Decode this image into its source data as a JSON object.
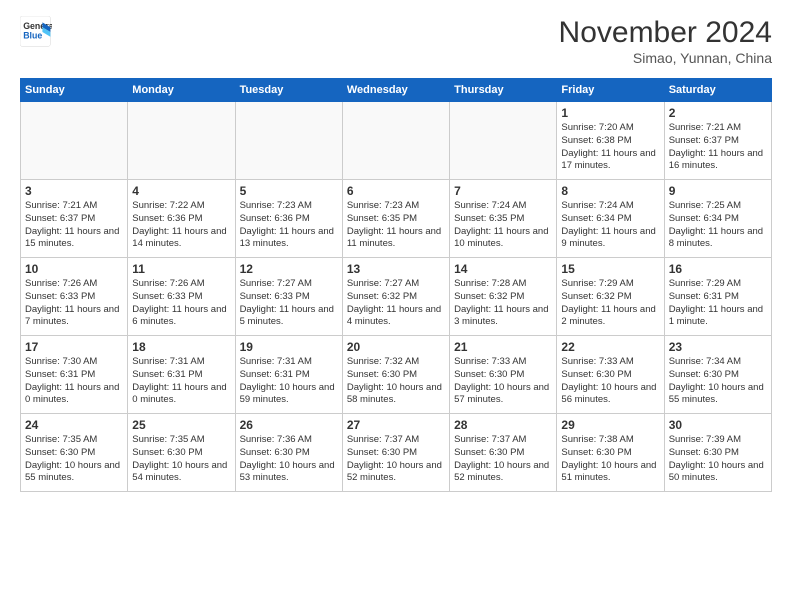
{
  "header": {
    "logo_line1": "General",
    "logo_line2": "Blue",
    "month_title": "November 2024",
    "subtitle": "Simao, Yunnan, China"
  },
  "days_of_week": [
    "Sunday",
    "Monday",
    "Tuesday",
    "Wednesday",
    "Thursday",
    "Friday",
    "Saturday"
  ],
  "weeks": [
    [
      {
        "day": "",
        "info": ""
      },
      {
        "day": "",
        "info": ""
      },
      {
        "day": "",
        "info": ""
      },
      {
        "day": "",
        "info": ""
      },
      {
        "day": "",
        "info": ""
      },
      {
        "day": "1",
        "info": "Sunrise: 7:20 AM\nSunset: 6:38 PM\nDaylight: 11 hours and 17 minutes."
      },
      {
        "day": "2",
        "info": "Sunrise: 7:21 AM\nSunset: 6:37 PM\nDaylight: 11 hours and 16 minutes."
      }
    ],
    [
      {
        "day": "3",
        "info": "Sunrise: 7:21 AM\nSunset: 6:37 PM\nDaylight: 11 hours and 15 minutes."
      },
      {
        "day": "4",
        "info": "Sunrise: 7:22 AM\nSunset: 6:36 PM\nDaylight: 11 hours and 14 minutes."
      },
      {
        "day": "5",
        "info": "Sunrise: 7:23 AM\nSunset: 6:36 PM\nDaylight: 11 hours and 13 minutes."
      },
      {
        "day": "6",
        "info": "Sunrise: 7:23 AM\nSunset: 6:35 PM\nDaylight: 11 hours and 11 minutes."
      },
      {
        "day": "7",
        "info": "Sunrise: 7:24 AM\nSunset: 6:35 PM\nDaylight: 11 hours and 10 minutes."
      },
      {
        "day": "8",
        "info": "Sunrise: 7:24 AM\nSunset: 6:34 PM\nDaylight: 11 hours and 9 minutes."
      },
      {
        "day": "9",
        "info": "Sunrise: 7:25 AM\nSunset: 6:34 PM\nDaylight: 11 hours and 8 minutes."
      }
    ],
    [
      {
        "day": "10",
        "info": "Sunrise: 7:26 AM\nSunset: 6:33 PM\nDaylight: 11 hours and 7 minutes."
      },
      {
        "day": "11",
        "info": "Sunrise: 7:26 AM\nSunset: 6:33 PM\nDaylight: 11 hours and 6 minutes."
      },
      {
        "day": "12",
        "info": "Sunrise: 7:27 AM\nSunset: 6:33 PM\nDaylight: 11 hours and 5 minutes."
      },
      {
        "day": "13",
        "info": "Sunrise: 7:27 AM\nSunset: 6:32 PM\nDaylight: 11 hours and 4 minutes."
      },
      {
        "day": "14",
        "info": "Sunrise: 7:28 AM\nSunset: 6:32 PM\nDaylight: 11 hours and 3 minutes."
      },
      {
        "day": "15",
        "info": "Sunrise: 7:29 AM\nSunset: 6:32 PM\nDaylight: 11 hours and 2 minutes."
      },
      {
        "day": "16",
        "info": "Sunrise: 7:29 AM\nSunset: 6:31 PM\nDaylight: 11 hours and 1 minute."
      }
    ],
    [
      {
        "day": "17",
        "info": "Sunrise: 7:30 AM\nSunset: 6:31 PM\nDaylight: 11 hours and 0 minutes."
      },
      {
        "day": "18",
        "info": "Sunrise: 7:31 AM\nSunset: 6:31 PM\nDaylight: 11 hours and 0 minutes."
      },
      {
        "day": "19",
        "info": "Sunrise: 7:31 AM\nSunset: 6:31 PM\nDaylight: 10 hours and 59 minutes."
      },
      {
        "day": "20",
        "info": "Sunrise: 7:32 AM\nSunset: 6:30 PM\nDaylight: 10 hours and 58 minutes."
      },
      {
        "day": "21",
        "info": "Sunrise: 7:33 AM\nSunset: 6:30 PM\nDaylight: 10 hours and 57 minutes."
      },
      {
        "day": "22",
        "info": "Sunrise: 7:33 AM\nSunset: 6:30 PM\nDaylight: 10 hours and 56 minutes."
      },
      {
        "day": "23",
        "info": "Sunrise: 7:34 AM\nSunset: 6:30 PM\nDaylight: 10 hours and 55 minutes."
      }
    ],
    [
      {
        "day": "24",
        "info": "Sunrise: 7:35 AM\nSunset: 6:30 PM\nDaylight: 10 hours and 55 minutes."
      },
      {
        "day": "25",
        "info": "Sunrise: 7:35 AM\nSunset: 6:30 PM\nDaylight: 10 hours and 54 minutes."
      },
      {
        "day": "26",
        "info": "Sunrise: 7:36 AM\nSunset: 6:30 PM\nDaylight: 10 hours and 53 minutes."
      },
      {
        "day": "27",
        "info": "Sunrise: 7:37 AM\nSunset: 6:30 PM\nDaylight: 10 hours and 52 minutes."
      },
      {
        "day": "28",
        "info": "Sunrise: 7:37 AM\nSunset: 6:30 PM\nDaylight: 10 hours and 52 minutes."
      },
      {
        "day": "29",
        "info": "Sunrise: 7:38 AM\nSunset: 6:30 PM\nDaylight: 10 hours and 51 minutes."
      },
      {
        "day": "30",
        "info": "Sunrise: 7:39 AM\nSunset: 6:30 PM\nDaylight: 10 hours and 50 minutes."
      }
    ]
  ]
}
